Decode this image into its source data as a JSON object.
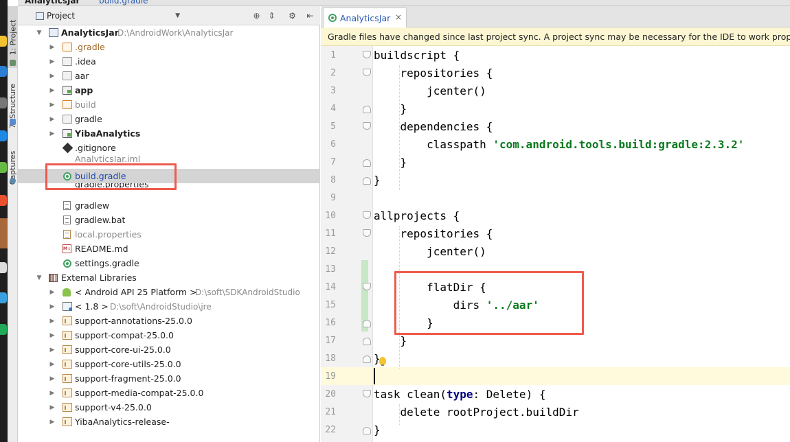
{
  "breadcrumb": {
    "project": "AnalyticsJar",
    "file": "build.gradle"
  },
  "tool_tabs": {
    "project": "1: Project",
    "structure": "7: Structure",
    "captures": "Captures"
  },
  "project_panel": {
    "selector_label": "Project",
    "root": {
      "name": "AnalyticsJar",
      "path": "D:\\AndroidWork\\AnalyticsJar"
    },
    "items": [
      {
        "label": ".gradle"
      },
      {
        "label": ".idea"
      },
      {
        "label": "aar"
      },
      {
        "label": "app"
      },
      {
        "label": "build"
      },
      {
        "label": "gradle"
      },
      {
        "label": "YibaAnalytics"
      },
      {
        "label": ".gitignore"
      },
      {
        "label": "AnalyticsJar.iml"
      },
      {
        "label": "build.gradle"
      },
      {
        "label": "gradle.properties"
      },
      {
        "label": "gradlew"
      },
      {
        "label": "gradlew.bat"
      },
      {
        "label": "local.properties"
      },
      {
        "label": "README.md"
      },
      {
        "label": "settings.gradle"
      }
    ],
    "external_libraries": {
      "label": "External Libraries",
      "items": [
        {
          "label": "< Android API 25 Platform >",
          "path": "D:\\soft\\SDKAndroidStudio"
        },
        {
          "label": "< 1.8 >",
          "path": "D:\\soft\\AndroidStudio\\jre"
        },
        {
          "label": "support-annotations-25.0.0"
        },
        {
          "label": "support-compat-25.0.0"
        },
        {
          "label": "support-core-ui-25.0.0"
        },
        {
          "label": "support-core-utils-25.0.0"
        },
        {
          "label": "support-fragment-25.0.0"
        },
        {
          "label": "support-media-compat-25.0.0"
        },
        {
          "label": "support-v4-25.0.0"
        },
        {
          "label": "YibaAnalytics-release-"
        }
      ]
    }
  },
  "editor": {
    "tab_label": "AnalyticsJar",
    "notification": "Gradle files have changed since last project sync. A project sync may be necessary for the IDE to work properly.",
    "line_numbers": [
      "1",
      "2",
      "3",
      "4",
      "5",
      "6",
      "7",
      "8",
      "9",
      "10",
      "11",
      "12",
      "13",
      "14",
      "15",
      "16",
      "17",
      "18",
      "19",
      "20",
      "21",
      "22"
    ],
    "code": {
      "l1": "buildscript {",
      "l2": "    repositories {",
      "l3": "        jcenter()",
      "l4": "    }",
      "l5": "    dependencies {",
      "l6_a": "        classpath ",
      "l6_s": "'com.android.tools.build:gradle:2.3.2'",
      "l7": "    }",
      "l8": "}",
      "l10": "allprojects {",
      "l11": "    repositories {",
      "l12": "        jcenter()",
      "l14": "        flatDir {",
      "l15_a": "            dirs ",
      "l15_s": "'../aar'",
      "l16": "        }",
      "l17": "    }",
      "l18": "}",
      "l20_a": "task clean(",
      "l20_k": "type",
      "l20_b": ": Delete) {",
      "l21": "    delete rootProject.buildDir",
      "l22": "}"
    }
  },
  "colors": {
    "highlight_box": "#ee5a4d",
    "string": "#0a7a1e",
    "link_blue": "#1a48b0",
    "notification_bg": "#fcf6d3"
  }
}
